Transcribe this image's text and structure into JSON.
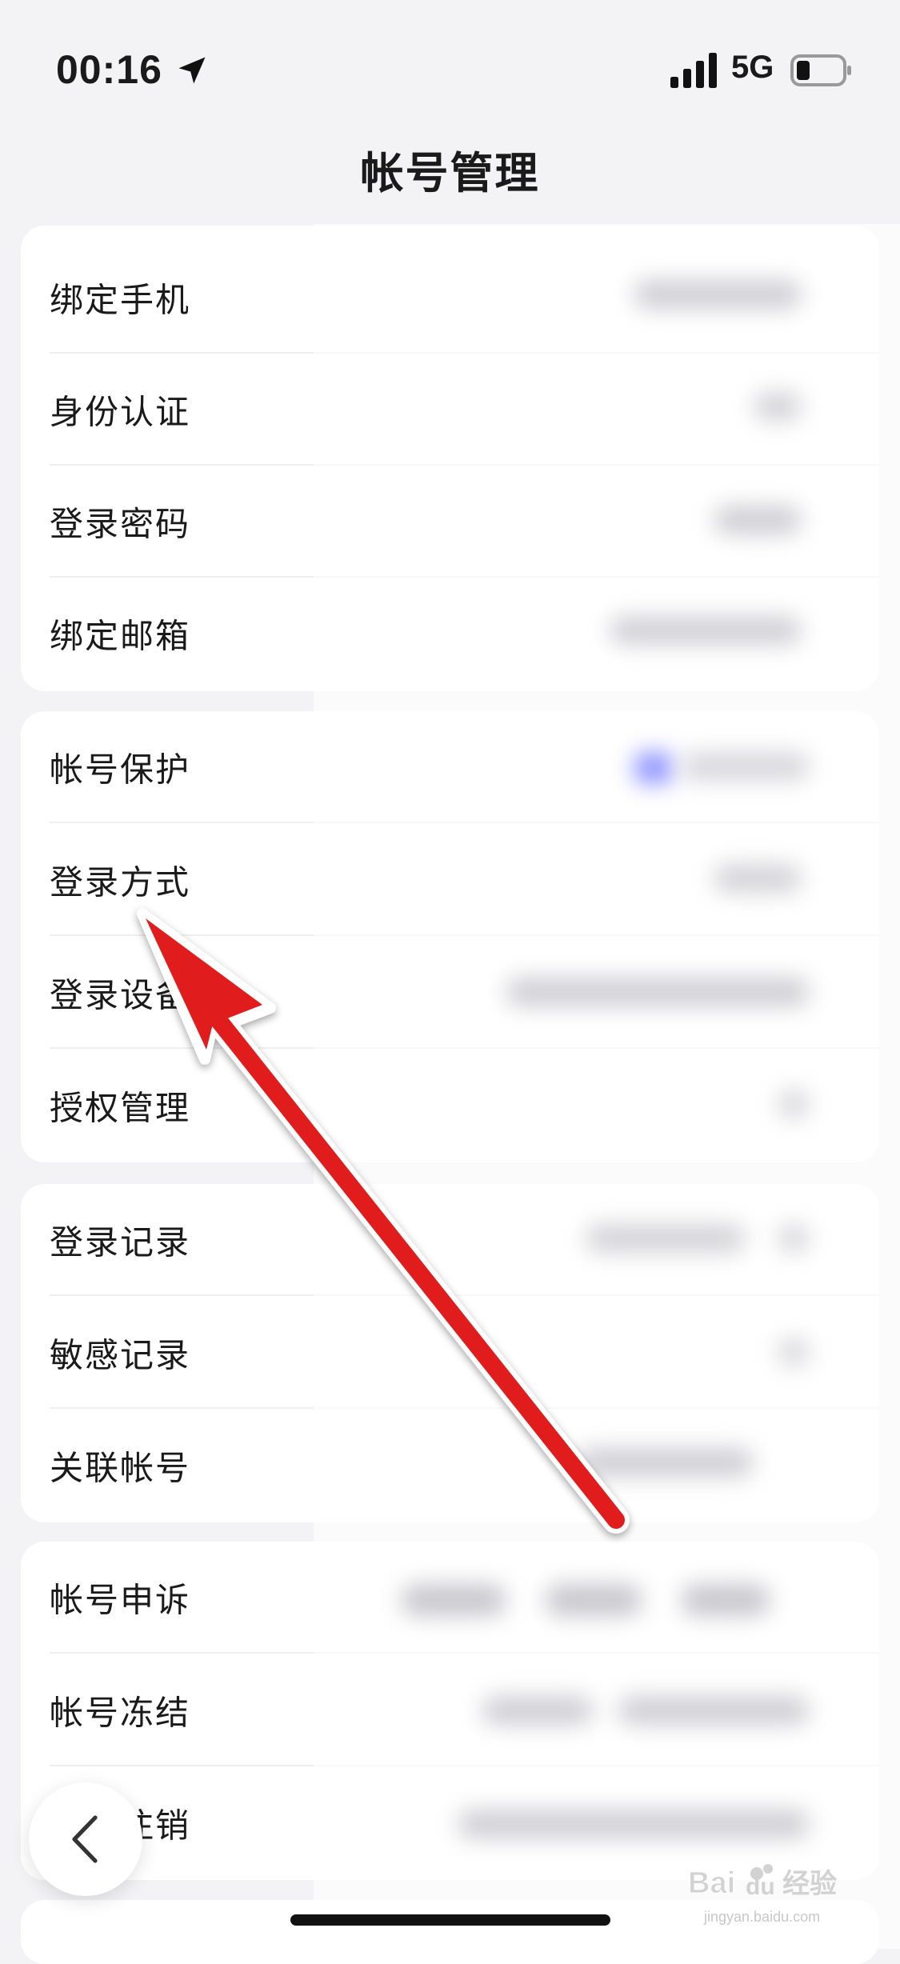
{
  "status_bar": {
    "time": "00:16",
    "network": "5G",
    "icons": [
      "location-arrow-icon",
      "cellular-signal-icon",
      "battery-icon"
    ]
  },
  "header": {
    "title": "帐号管理"
  },
  "sections": [
    {
      "items": [
        {
          "label": "绑定手机"
        },
        {
          "label": "身份认证"
        },
        {
          "label": "登录密码"
        },
        {
          "label": "绑定邮箱"
        }
      ]
    },
    {
      "items": [
        {
          "label": "帐号保护"
        },
        {
          "label": "登录方式"
        },
        {
          "label": "登录设备"
        },
        {
          "label": "授权管理"
        }
      ]
    },
    {
      "items": [
        {
          "label": "登录记录"
        },
        {
          "label": "敏感记录"
        },
        {
          "label": "关联帐号"
        }
      ]
    },
    {
      "items": [
        {
          "label": "帐号申诉"
        },
        {
          "label": "帐号冻结"
        },
        {
          "label": "帐号注销"
        }
      ]
    }
  ],
  "watermark": {
    "text": "jingyan.baidu.com",
    "brand": "Baidu经验"
  },
  "colors": {
    "accent_arrow": "#e01e1e",
    "background": "#f3f3f5",
    "card": "#ffffff"
  },
  "controls": {
    "back_icon": "chevron-left-icon"
  }
}
